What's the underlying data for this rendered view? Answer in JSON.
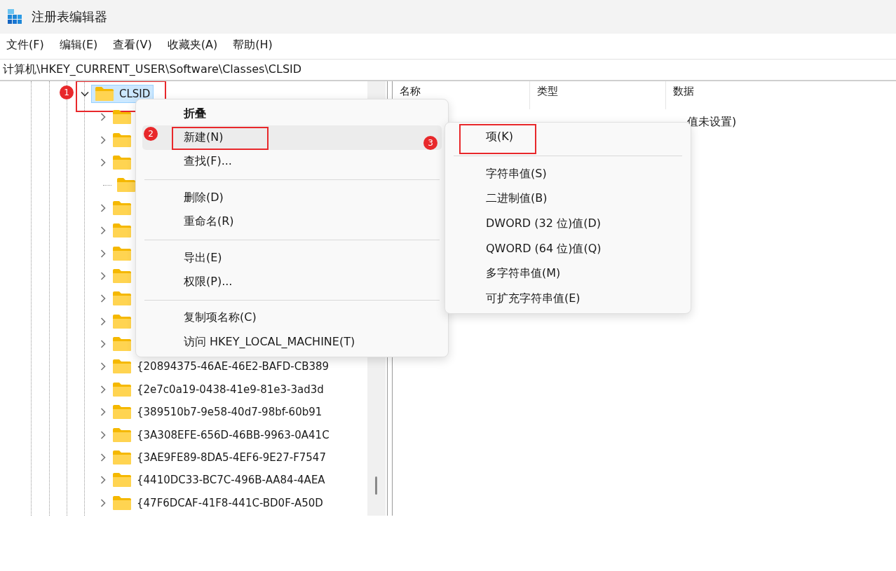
{
  "window": {
    "title": "注册表编辑器"
  },
  "menu_bar": [
    "文件(F)",
    "编辑(E)",
    "查看(V)",
    "收藏夹(A)",
    "帮助(H)"
  ],
  "address": "计算机\\HKEY_CURRENT_USER\\Software\\Classes\\CLSID",
  "tree": [
    {
      "label": "CLSID",
      "expanded": true,
      "selected": true,
      "outlined": true,
      "marker": "1",
      "children": [
        {
          "expandable": true
        },
        {
          "expandable": true
        },
        {
          "expandable": true
        },
        {
          "expandable": false
        },
        {
          "expandable": true
        },
        {
          "expandable": true
        },
        {
          "expandable": true
        },
        {
          "expandable": true
        },
        {
          "expandable": true
        },
        {
          "expandable": true
        },
        {
          "expandable": true
        },
        {
          "label": "{20894375-46AE-46E2-BAFD-CB389",
          "expandable": true
        },
        {
          "label": "{2e7c0a19-0438-41e9-81e3-3ad3d",
          "expandable": true
        },
        {
          "label": "{389510b7-9e58-40d7-98bf-60b91",
          "expandable": true
        },
        {
          "label": "{3A308EFE-656D-46BB-9963-0A41C",
          "expandable": true
        },
        {
          "label": "{3AE9FE89-8DA5-4EF6-9E27-F7547",
          "expandable": true
        },
        {
          "label": "{4410DC33-BC7C-496B-AA84-4AEA",
          "expandable": true
        },
        {
          "label": "{47F6DCAF-41F8-441C-BD0F-A50D",
          "expandable": true
        }
      ]
    }
  ],
  "values": {
    "columns": [
      "名称",
      "类型",
      "数据"
    ],
    "rows": [
      {
        "data": "值未设置)"
      }
    ]
  },
  "context_menu": {
    "items": [
      {
        "kind": "item",
        "label": "折叠",
        "bold": true,
        "hovered": false
      },
      {
        "kind": "item",
        "label": "新建(N)",
        "hovered": true,
        "outlined": true,
        "marker": "2"
      },
      {
        "kind": "item",
        "label": "查找(F)...",
        "hovered": false
      },
      {
        "kind": "separator"
      },
      {
        "kind": "item",
        "label": "删除(D)",
        "hovered": false
      },
      {
        "kind": "item",
        "label": "重命名(R)",
        "hovered": false
      },
      {
        "kind": "separator"
      },
      {
        "kind": "item",
        "label": "导出(E)",
        "hovered": false
      },
      {
        "kind": "item",
        "label": "权限(P)...",
        "hovered": false
      },
      {
        "kind": "separator"
      },
      {
        "kind": "item",
        "label": "复制项名称(C)",
        "hovered": false
      },
      {
        "kind": "item",
        "label": "访问 HKEY_LOCAL_MACHINE(T)",
        "hovered": false
      }
    ]
  },
  "submenu": {
    "items": [
      {
        "kind": "item",
        "label": "项(K)",
        "outlined": true,
        "marker": "3"
      },
      {
        "kind": "separator"
      },
      {
        "kind": "item",
        "label": "字符串值(S)"
      },
      {
        "kind": "item",
        "label": "二进制值(B)"
      },
      {
        "kind": "item",
        "label": "DWORD (32 位)值(D)"
      },
      {
        "kind": "item",
        "label": "QWORD (64 位)值(Q)"
      },
      {
        "kind": "item",
        "label": "多字符串值(M)"
      },
      {
        "kind": "item",
        "label": "可扩充字符串值(E)"
      }
    ]
  }
}
